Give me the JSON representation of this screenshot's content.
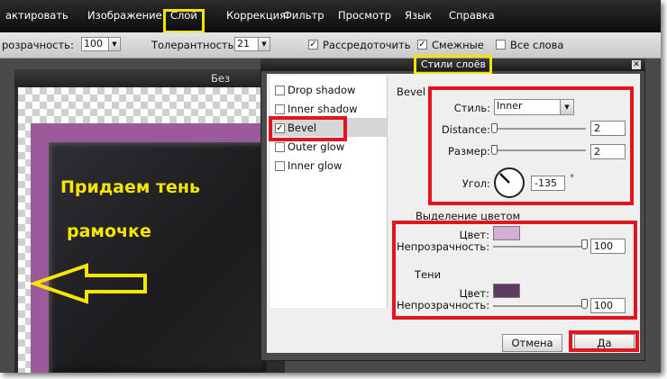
{
  "menu": {
    "items": [
      "актировать",
      "Изображение",
      "Слой",
      "Коррекция",
      "Фильтр",
      "Просмотр",
      "Язык",
      "Справка"
    ]
  },
  "options": {
    "opacity_label": "розрачность:",
    "opacity_value": "100",
    "tolerance_label": "Толерантность:",
    "tolerance_value": "21",
    "spread_label": "Рассредоточить",
    "contiguous_label": "Смежные",
    "all_words_label": "Все слова",
    "spread_checked": true,
    "contiguous_checked": true,
    "all_words_checked": false
  },
  "document": {
    "title": "Без имени"
  },
  "annotations": {
    "line1": "Придаем тень",
    "line2": "рамочке"
  },
  "dialog": {
    "title": "Стили слоёв",
    "close": "✕",
    "styles": [
      {
        "label": "Drop shadow",
        "checked": false
      },
      {
        "label": "Inner shadow",
        "checked": false
      },
      {
        "label": "Bevel",
        "checked": true
      },
      {
        "label": "Outer glow",
        "checked": false
      },
      {
        "label": "Inner glow",
        "checked": false
      }
    ],
    "bevel": {
      "section_label": "Bevel",
      "style_label": "Стиль:",
      "style_value": "Inner",
      "distance_label": "Distance:",
      "distance_value": "2",
      "size_label": "Размер:",
      "size_value": "2",
      "angle_label": "Угол:",
      "angle_value": "-135",
      "angle_unit": "°"
    },
    "highlight": {
      "section_label": "Выделение цветом",
      "color_label": "Цвет:",
      "color": "#d4aed4",
      "opacity_label": "Непрозрачность:",
      "opacity_value": "100"
    },
    "shadow": {
      "section_label": "Тени",
      "color_label": "Цвет:",
      "color": "#5e3a63",
      "opacity_label": "Непрозрачность:",
      "opacity_value": "100"
    },
    "cancel_label": "Отмена",
    "ok_label": "Да"
  },
  "colors": {
    "highlight_yellow": "#f2e600",
    "highlight_red": "#e3141e",
    "frame_purple": "#9b5a9a"
  }
}
